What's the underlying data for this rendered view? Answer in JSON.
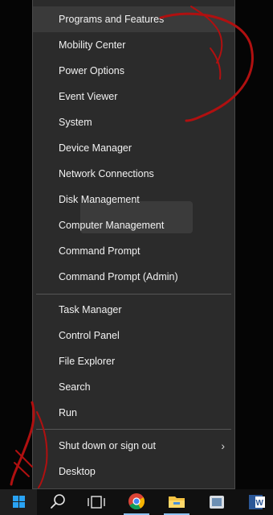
{
  "menu": {
    "group1": [
      {
        "id": "programs-and-features",
        "label": "Programs and Features"
      },
      {
        "id": "mobility-center",
        "label": "Mobility Center"
      },
      {
        "id": "power-options",
        "label": "Power Options"
      },
      {
        "id": "event-viewer",
        "label": "Event Viewer"
      },
      {
        "id": "system",
        "label": "System"
      },
      {
        "id": "device-manager",
        "label": "Device Manager"
      },
      {
        "id": "network-connections",
        "label": "Network Connections"
      },
      {
        "id": "disk-management",
        "label": "Disk Management"
      },
      {
        "id": "computer-management",
        "label": "Computer Management"
      },
      {
        "id": "command-prompt",
        "label": "Command Prompt"
      },
      {
        "id": "command-prompt-admin",
        "label": "Command Prompt (Admin)"
      }
    ],
    "group2": [
      {
        "id": "task-manager",
        "label": "Task Manager"
      },
      {
        "id": "control-panel",
        "label": "Control Panel"
      },
      {
        "id": "file-explorer",
        "label": "File Explorer"
      },
      {
        "id": "search",
        "label": "Search"
      },
      {
        "id": "run",
        "label": "Run"
      }
    ],
    "group3": [
      {
        "id": "shut-down-or-sign-out",
        "label": "Shut down or sign out",
        "has_submenu": true
      },
      {
        "id": "desktop",
        "label": "Desktop"
      }
    ],
    "highlighted_item": "programs-and-features"
  },
  "taskbar": {
    "icons": [
      "windows-start-icon",
      "search-icon",
      "task-view-icon",
      "chrome-icon",
      "file-explorer-icon",
      "app-icon",
      "word-icon"
    ]
  },
  "colors": {
    "menu_bg": "#2b2b2b",
    "menu_text": "#f2f2f2",
    "highlight_bg": "#3a3a3a",
    "windows_blue": "#29a3f5",
    "annotation_red": "#b01010"
  }
}
